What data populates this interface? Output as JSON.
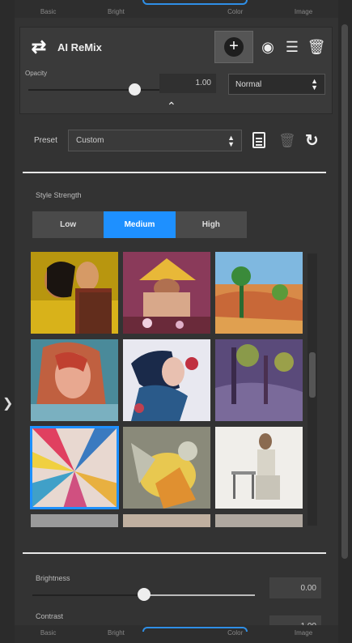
{
  "tabs_top": [
    "Basic",
    "Bright",
    "Color",
    "Image"
  ],
  "tabs_bottom": [
    "Basic",
    "Bright",
    "Color",
    "Image"
  ],
  "layer": {
    "title": "AI ReMix",
    "opacity_label": "Opacity",
    "opacity_value": "1.00",
    "blend_mode": "Normal"
  },
  "preset": {
    "label": "Preset",
    "value": "Custom"
  },
  "style_strength": {
    "label": "Style Strength",
    "options": [
      "Low",
      "Medium",
      "High"
    ],
    "selected": "Medium"
  },
  "styles": [
    {
      "name": "couple-gold",
      "selected": false
    },
    {
      "name": "farmer-hat",
      "selected": false
    },
    {
      "name": "desert-joshua-tree",
      "selected": false
    },
    {
      "name": "woman-portrait-teal",
      "selected": false
    },
    {
      "name": "woman-splash",
      "selected": false
    },
    {
      "name": "forest-violet",
      "selected": false
    },
    {
      "name": "geometric-rays",
      "selected": true
    },
    {
      "name": "abstract-yellow",
      "selected": false
    },
    {
      "name": "man-sitting-white",
      "selected": false
    }
  ],
  "adjustments": {
    "brightness_label": "Brightness",
    "brightness_value": "0.00",
    "contrast_label": "Contrast",
    "contrast_value": "1.00"
  },
  "colors": {
    "accent": "#1e90ff",
    "panel": "#333333"
  }
}
